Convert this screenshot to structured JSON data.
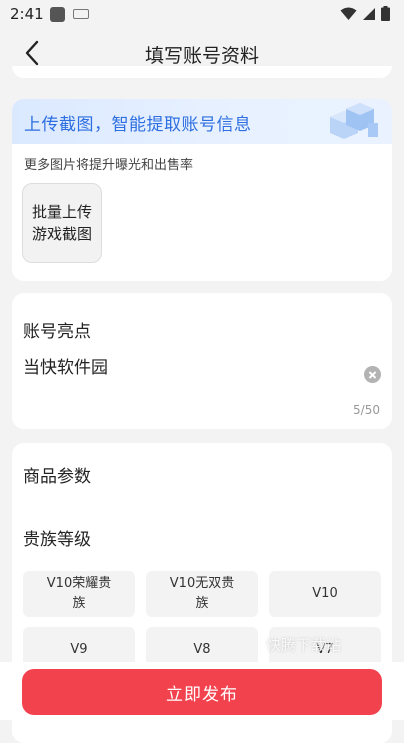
{
  "status_bar": {
    "time": "2:41"
  },
  "header": {
    "title": "填写账号资料"
  },
  "upload_section": {
    "banner_text": "上传截图，智能提取账号信息",
    "subtitle": "更多图片将提升曝光和出售率",
    "upload_button_line1": "批量上传",
    "upload_button_line2": "游戏截图"
  },
  "highlight_section": {
    "title": "账号亮点",
    "value": "当快软件园",
    "counter": "5/50"
  },
  "params_section": {
    "title": "商品参数",
    "level_title": "贵族等级",
    "options": [
      {
        "line1": "V10荣耀贵",
        "line2": "族"
      },
      {
        "line1": "V10无双贵",
        "line2": "族"
      },
      {
        "line1": "V10",
        "line2": ""
      },
      {
        "line1": "V9",
        "line2": ""
      },
      {
        "line1": "V8",
        "line2": ""
      },
      {
        "line1": "V7",
        "line2": ""
      }
    ]
  },
  "watermark": "快腾下载站",
  "footer": {
    "publish_label": "立即发布"
  },
  "colors": {
    "accent": "#f2424e",
    "banner_text": "#2d6fe0",
    "background": "#f3f3f3"
  }
}
